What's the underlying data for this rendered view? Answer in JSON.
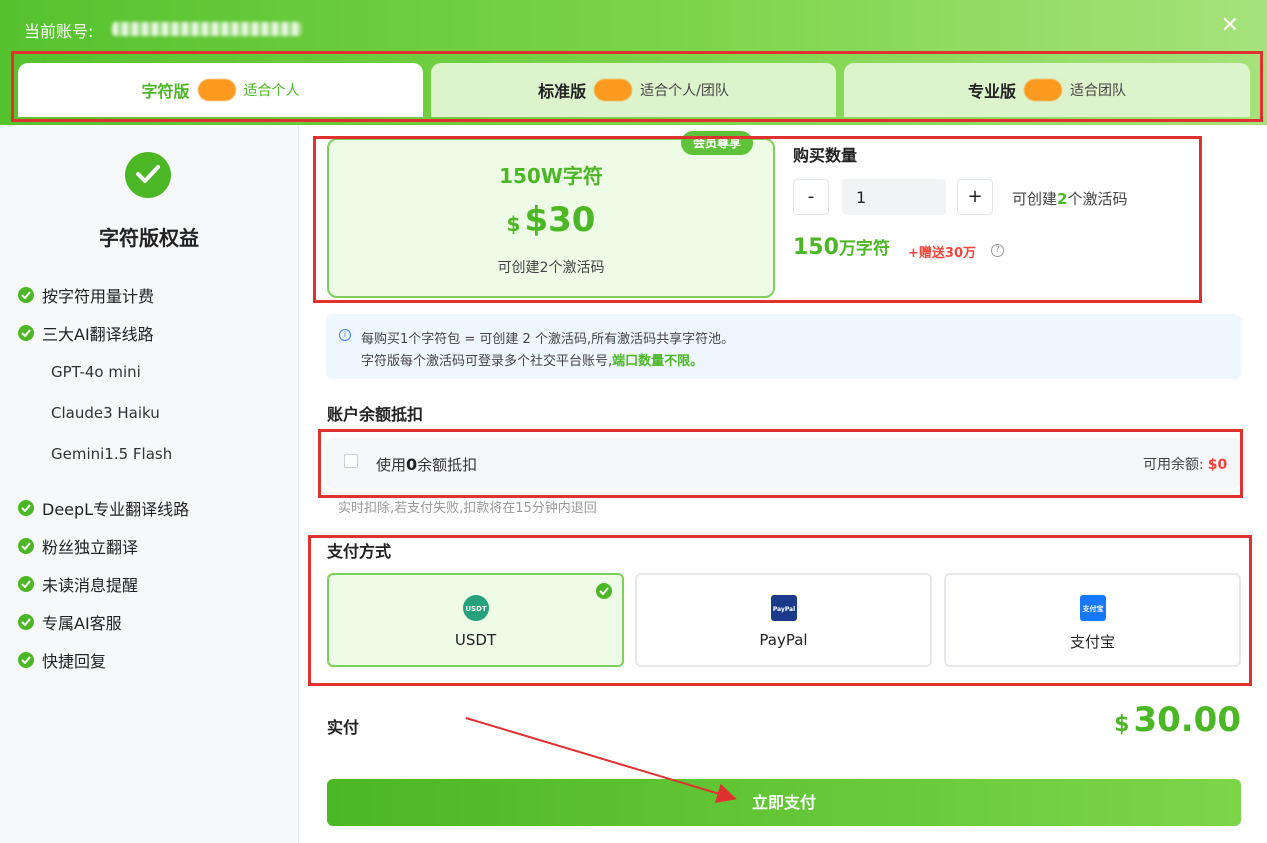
{
  "header": {
    "account_label": "当前账号:",
    "close_icon": "✕",
    "colors": {
      "green": "#4bb724",
      "red": "#e03131",
      "orange": "#fb9a1f"
    }
  },
  "tabs": [
    {
      "name": "字符版",
      "sub": "适合个人",
      "active": true
    },
    {
      "name": "标准版",
      "sub": "适合个人/团队",
      "active": false
    },
    {
      "name": "专业版",
      "sub": "适合团队",
      "active": false
    }
  ],
  "sidebar": {
    "title": "字符版权益",
    "features": {
      "f1": "按字符用量计费",
      "f2": "三大AI翻译线路",
      "f2_sub1": "GPT-4o mini",
      "f2_sub2": "Claude3 Haiku",
      "f2_sub3": "Gemini1.5 Flash",
      "f3": "DeepL专业翻译线路",
      "f4": "粉丝独立翻译",
      "f5": "未读消息提醒",
      "f6": "专属AI客服",
      "f7": "快捷回复"
    }
  },
  "plan": {
    "ribbon": "会员尊享",
    "chars": "150W字符",
    "currency": "$",
    "price": "$30",
    "note": "可创建2个激活码"
  },
  "quantity": {
    "title": "购买数量",
    "minus": "-",
    "value": "1",
    "plus": "+",
    "info_pre": "可创建",
    "info_num": "2",
    "info_post": "个激活码",
    "total_num": "150",
    "total_unit": "万字符",
    "bonus": "+赠送30万",
    "help_icon": "?"
  },
  "info": {
    "icon": "i",
    "line1": "每购买1个字符包 = 可创建 2 个激活码,所有激活码共享字符池。",
    "line2_pre": "字符版每个激活码可登录多个社交平台账号,",
    "line2_em": "端口数量不限。"
  },
  "balance": {
    "title": "账户余额抵扣",
    "use_pre": "使用",
    "use_num": "0",
    "use_post": "余额抵扣",
    "avail_label": "可用余额:",
    "avail_value": "$0",
    "note": "实时扣除,若支付失败,扣款将在15分钟内退回"
  },
  "payment": {
    "title": "支付方式",
    "methods": [
      {
        "label": "USDT",
        "icon_text": "USDT",
        "selected": true
      },
      {
        "label": "PayPal",
        "icon_text": "PayPal",
        "selected": false
      },
      {
        "label": "支付宝",
        "icon_text": "支付宝",
        "selected": false
      }
    ]
  },
  "total": {
    "label": "实付",
    "currency": "$",
    "amount": "30.00"
  },
  "submit": {
    "label": "立即支付"
  }
}
